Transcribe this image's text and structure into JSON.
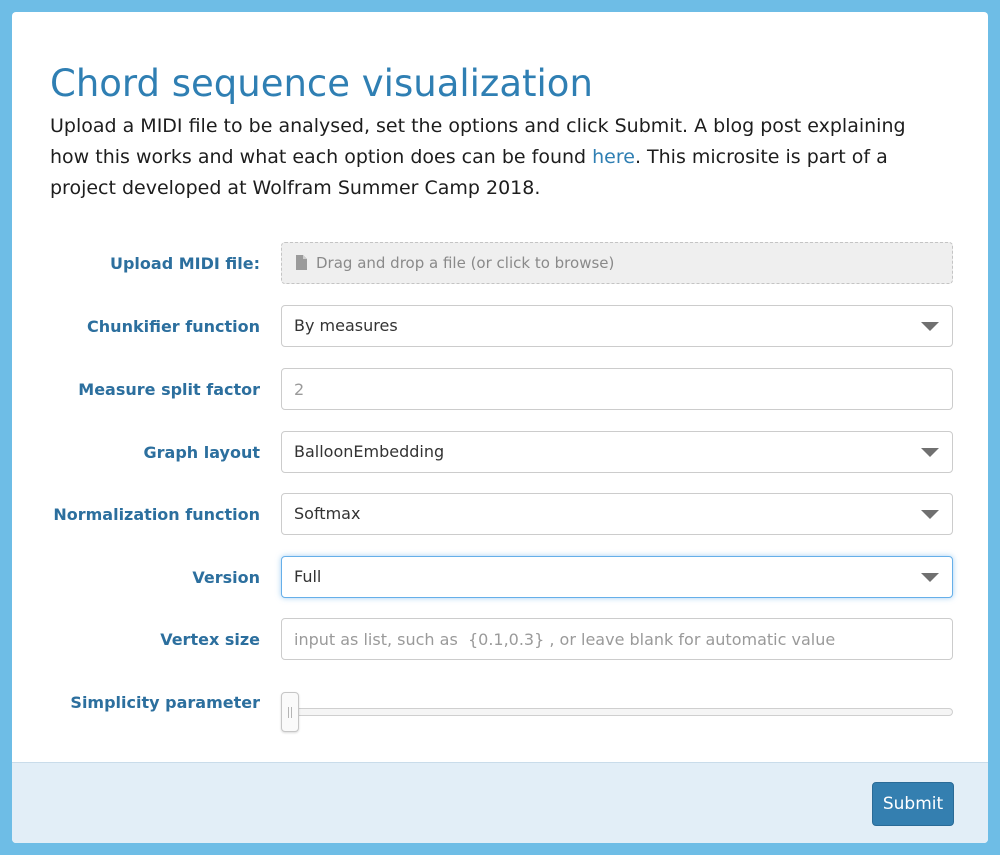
{
  "page": {
    "title": "Chord sequence visualization",
    "intro_before_link": "Upload a MIDI file to be analysed, set the options and click Submit. A blog post explaining how this works and what each option does can be found ",
    "intro_link": "here",
    "intro_after_link": ". This microsite is part of a project developed at Wolfram Summer Camp 2018."
  },
  "form": {
    "upload": {
      "label": "Upload MIDI file:",
      "placeholder": "Drag and drop a file (or click to browse)"
    },
    "chunkifier": {
      "label": "Chunkifier function",
      "value": "By measures"
    },
    "measure_split": {
      "label": "Measure split factor",
      "value": "2"
    },
    "graph_layout": {
      "label": "Graph layout",
      "value": "BalloonEmbedding"
    },
    "normalization": {
      "label": "Normalization function",
      "value": "Softmax"
    },
    "version": {
      "label": "Version",
      "value": "Full"
    },
    "vertex_size": {
      "label": "Vertex size",
      "value": "",
      "placeholder": "input as list, such as  {0.1,0.3} , or leave blank for automatic value"
    },
    "simplicity": {
      "label": "Simplicity parameter",
      "level": 0
    }
  },
  "footer": {
    "submit_label": "Submit"
  },
  "colors": {
    "background": "#6ebde6",
    "accent": "#2f7fb3",
    "label": "#2c6f9e",
    "button": "#347fb0",
    "footer": "#e2eef7"
  }
}
